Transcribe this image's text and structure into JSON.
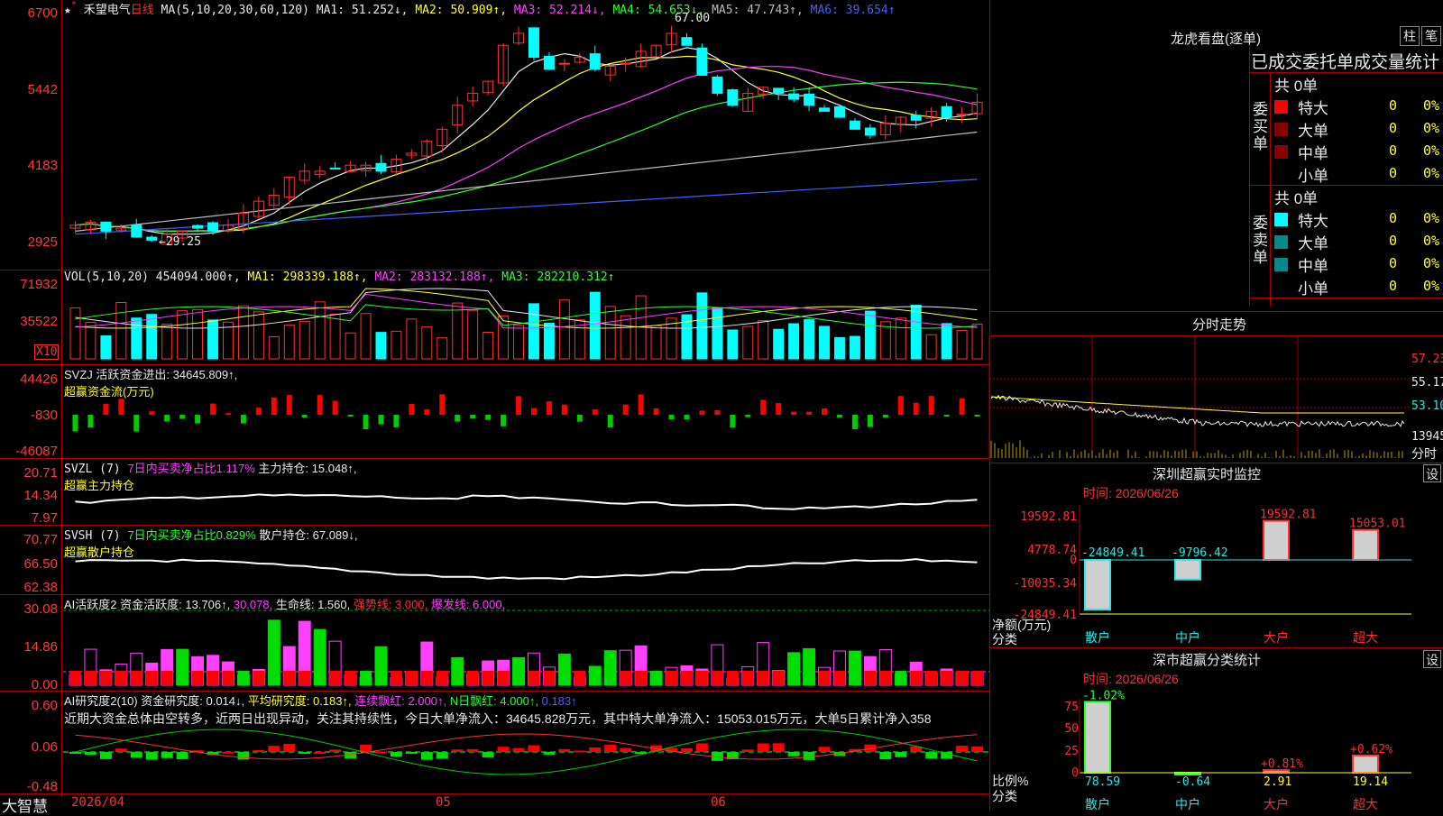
{
  "stock": {
    "star": "★",
    "name": "禾望电气",
    "period": "日线"
  },
  "price_pane": {
    "ma_header": "MA(5,10,20,30,60,120)",
    "ma1": "MA1: 51.252↓,",
    "ma2": "MA2: 50.909↑,",
    "ma3": "MA3: 52.214↓,",
    "ma4": "MA4: 54.653↓,",
    "ma5": "MA5: 47.743↑,",
    "ma6": "MA6: 39.654↑",
    "yticks": [
      "6700",
      "5442",
      "4183",
      "2925"
    ],
    "high_label": "67.00",
    "low_label": "←29.25"
  },
  "vol_pane": {
    "header": "VOL(5,10,20)",
    "value": "454094.000↑,",
    "ma1": "MA1: 298339.188↑,",
    "ma2": "MA2: 283132.188↑,",
    "ma3": "MA3: 282210.312↑",
    "yticks": [
      "71932",
      "35522"
    ],
    "unit": "X10"
  },
  "svzj_pane": {
    "header": "SVZJ  活跃资金进出: 34645.809↑,",
    "sub": "超赢资金流(万元)",
    "yticks": [
      "44426",
      "-830",
      "-46087"
    ]
  },
  "svzl_pane": {
    "header": "SVZL (7)",
    "part1": "7日内买卖净占比1.117%",
    "part2": " 主力持仓: 15.048↑,",
    "sub": "超赢主力持仓",
    "yticks": [
      "20.71",
      "14.34",
      "7.97"
    ]
  },
  "svsh_pane": {
    "header": "SVSH (7)",
    "part1": "7日内买卖净占比0.829%",
    "part2": " 散户持仓: 67.089↓,",
    "sub": "超赢散户持仓",
    "yticks": [
      "70.77",
      "66.50",
      "62.38"
    ]
  },
  "ai1_pane": {
    "header": "AI活跃度2",
    "t1": " 资金活跃度: 13.706↑,",
    "t2": " 30.078,",
    "t3": " 生命线: 1.560,",
    "t4": " 强势线: 3.000,",
    "t5": " 爆发线: 6.000,",
    "yticks": [
      "30.08",
      "14.86",
      "0.00"
    ]
  },
  "ai2_pane": {
    "header": "AI研究度2(10)",
    "t1": " 资金研究度: 0.014↓,",
    "t2": " 平均研究度: 0.183↑,",
    "t3": " 连续飘红: 2.000↑,",
    "t4": " N日飘红: 4.000↑,",
    "t5": " 0.183↑",
    "text": "近期大资金总体由空转多，近两日出现异动，关注其持续性，今日大单净流入：34645.828万元，其中特大单净流入：15053.015万元，大单5日累计净入358",
    "yticks": [
      "0.60",
      "0.06",
      "-0.48"
    ]
  },
  "xaxis": {
    "brand": "大智慧",
    "labels": [
      "2026/04",
      "05",
      "06"
    ]
  },
  "dragon": {
    "title": "龙虎看盘(逐单)",
    "btn1": "柱",
    "btn2": "笔",
    "subtitle": "已成交委托单成交量统计",
    "buy_label": "委买单",
    "sell_label": "委卖单",
    "buy_total": "共 0单",
    "sell_total": "共 0单",
    "rows": [
      {
        "name": "特大",
        "val": "0",
        "pct": "0%"
      },
      {
        "name": "大单",
        "val": "0",
        "pct": "0%"
      },
      {
        "name": "中单",
        "val": "0",
        "pct": "0%"
      },
      {
        "name": "小单",
        "val": "0",
        "pct": "0%"
      }
    ]
  },
  "intraday": {
    "title": "分时走势",
    "yticks": [
      "57.23",
      "55.17",
      "53.10",
      "13945"
    ],
    "bottom_label": "分时"
  },
  "monitor": {
    "title": "深圳超赢实时监控",
    "btn": "设",
    "time": "时间: 2026/06/26",
    "yticks": [
      "19592.81",
      "4778.74",
      "0",
      "-10035.34",
      "-24849.41"
    ],
    "ylabel1": "净额(万元)",
    "ylabel2": "分类",
    "categories": [
      "散户",
      "中户",
      "大户",
      "超大"
    ],
    "values": [
      -24849.41,
      -9796.42,
      19592.81,
      15053.01
    ],
    "value_labels": [
      "-24849.41",
      "-9796.42",
      "19592.81",
      "15053.01"
    ]
  },
  "classify": {
    "title": "深市超赢分类统计",
    "btn": "设",
    "time": "时间: 2026/06/26",
    "yticks": [
      "75",
      "50",
      "25",
      "0"
    ],
    "ylabel1": "比例%",
    "ylabel2": "分类",
    "categories": [
      "散户",
      "中户",
      "大户",
      "超大"
    ],
    "values": [
      78.59,
      -0.64,
      2.91,
      19.14
    ],
    "value_labels": [
      "78.59",
      "-0.64",
      "2.91",
      "19.14"
    ],
    "change_labels": [
      "-1.02%",
      "",
      "+0.81%",
      "+0.62%"
    ]
  },
  "chart_data": [
    {
      "type": "candlestick",
      "title": "禾望电气 日线",
      "y_range": [
        29.25,
        67.0
      ],
      "high": 67.0,
      "low": 29.25,
      "series": [
        {
          "name": "MA1",
          "last": 51.252
        },
        {
          "name": "MA2",
          "last": 50.909
        },
        {
          "name": "MA3",
          "last": 52.214
        },
        {
          "name": "MA4",
          "last": 54.653
        },
        {
          "name": "MA5",
          "last": 47.743
        },
        {
          "name": "MA6",
          "last": 39.654
        }
      ]
    },
    {
      "type": "bar",
      "title": "VOL(5,10,20)",
      "last": 454094.0,
      "series": [
        {
          "name": "MA1",
          "last": 298339.188
        },
        {
          "name": "MA2",
          "last": 283132.188
        },
        {
          "name": "MA3",
          "last": 282210.312
        }
      ]
    },
    {
      "type": "bar",
      "title": "SVZJ 活跃资金进出",
      "last": 34645.809,
      "ylim": [
        -46087,
        44426
      ]
    },
    {
      "type": "line",
      "title": "SVZL 主力持仓",
      "last": 15.048,
      "ylim": [
        7.97,
        20.71
      ]
    },
    {
      "type": "line",
      "title": "SVSH 散户持仓",
      "last": 67.089,
      "ylim": [
        62.38,
        70.77
      ]
    },
    {
      "type": "bar",
      "title": "AI活跃度2",
      "last": 13.706,
      "ylim": [
        0,
        30.08
      ]
    },
    {
      "type": "bar",
      "title": "AI研究度2(10)",
      "last": 0.014,
      "ylim": [
        -0.48,
        0.6
      ]
    },
    {
      "type": "bar",
      "title": "深圳超赢实时监控",
      "categories": [
        "散户",
        "中户",
        "大户",
        "超大"
      ],
      "values": [
        -24849.41,
        -9796.42,
        19592.81,
        15053.01
      ]
    },
    {
      "type": "bar",
      "title": "深市超赢分类统计",
      "categories": [
        "散户",
        "中户",
        "大户",
        "超大"
      ],
      "values": [
        78.59,
        -0.64,
        2.91,
        19.14
      ]
    }
  ]
}
